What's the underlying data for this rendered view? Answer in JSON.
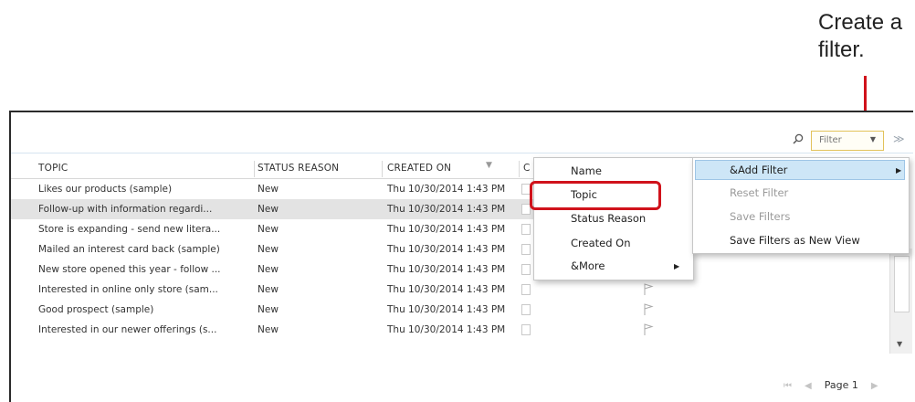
{
  "annotation": {
    "line1": "Create a",
    "line2": "filter.",
    "accent": "#d0121b"
  },
  "toolbar": {
    "search_icon": "search-icon",
    "filter_label": "Filter",
    "filter_dropdown_icon": "▼",
    "expand_icon": "≫"
  },
  "grid": {
    "columns": [
      "TOPIC",
      "STATUS REASON",
      "CREATED ON",
      "C"
    ],
    "rows": [
      {
        "topic": "Likes our products (sample)",
        "status": "New",
        "created": "Thu 10/30/2014 1:43 PM"
      },
      {
        "topic": "Follow-up with information regardi...",
        "status": "New",
        "created": "Thu 10/30/2014 1:43 PM"
      },
      {
        "topic": "Store is expanding - send new litera...",
        "status": "New",
        "created": "Thu 10/30/2014 1:43 PM"
      },
      {
        "topic": "Mailed an interest card back  (sample)",
        "status": "New",
        "created": "Thu 10/30/2014 1:43 PM"
      },
      {
        "topic": "New store opened this year - follow ...",
        "status": "New",
        "created": "Thu 10/30/2014 1:43 PM"
      },
      {
        "topic": "Interested in online only store (sam...",
        "status": "New",
        "created": "Thu 10/30/2014 1:43 PM"
      },
      {
        "topic": "Good prospect (sample)",
        "status": "New",
        "created": "Thu 10/30/2014 1:43 PM"
      },
      {
        "topic": "Interested in our newer offerings (s...",
        "status": "New",
        "created": "Thu 10/30/2014 1:43 PM"
      }
    ]
  },
  "pager": {
    "first": "⏮",
    "prev": "◀",
    "page_label": "Page 1",
    "next": "▶"
  },
  "filter_menu": {
    "items": [
      "&Add Filter",
      "Reset Filter",
      "Save Filters",
      "Save Filters as New View"
    ]
  },
  "field_submenu": {
    "items": [
      "Name",
      "Topic",
      "Status Reason",
      "Created On",
      "&More"
    ]
  }
}
